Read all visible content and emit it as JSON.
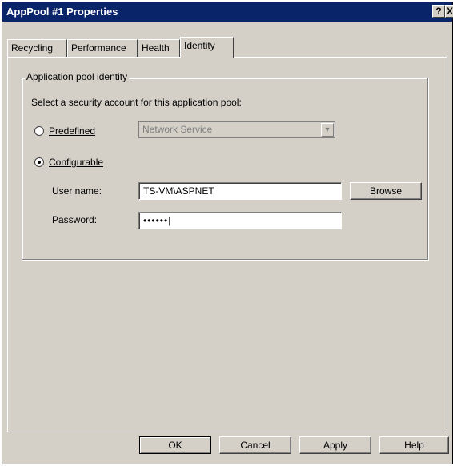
{
  "window": {
    "title": "AppPool #1 Properties",
    "help_glyph": "?",
    "close_glyph": "X"
  },
  "tabs": [
    {
      "label": "Recycling",
      "active": false
    },
    {
      "label": "Performance",
      "active": false
    },
    {
      "label": "Health",
      "active": false
    },
    {
      "label": "Identity",
      "active": true
    }
  ],
  "identity": {
    "group_label": "Application pool identity",
    "instruction": "Select a security account for this application pool:",
    "predefined": {
      "label": "Predefined",
      "selected": false,
      "combo_value": "Network Service",
      "combo_enabled": false
    },
    "configurable": {
      "label": "Configurable",
      "selected": true
    },
    "username": {
      "label": "User name:",
      "value": "TS-VM\\ASPNET"
    },
    "password": {
      "label": "Password:",
      "value": "••••••"
    },
    "browse_label": "Browse"
  },
  "footer": {
    "ok": "OK",
    "cancel": "Cancel",
    "apply": "Apply",
    "help": "Help"
  },
  "colors": {
    "titlebar": "#0a246a",
    "face": "#d4d0c8"
  }
}
